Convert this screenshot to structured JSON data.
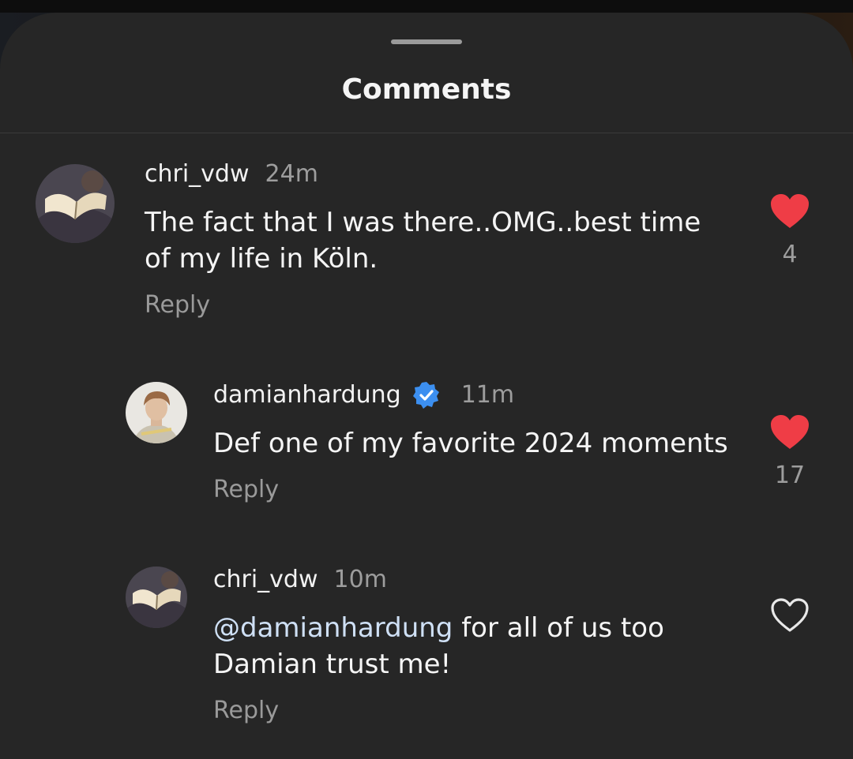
{
  "sheet": {
    "title": "Comments"
  },
  "comments": [
    {
      "username": "chri_vdw",
      "time": "24m",
      "text_line1": "The fact that I was there..OMG..best time",
      "text_line2": "of my life in Köln.",
      "reply_label": "Reply",
      "liked": true,
      "like_count": "4",
      "avatar": "open-book-photo"
    },
    {
      "username": "damianhardung",
      "verified": true,
      "time": "11m",
      "text_line1": "Def one of my favorite 2024 moments",
      "reply_label": "Reply",
      "liked": true,
      "like_count": "17",
      "avatar": "profile-photo"
    },
    {
      "username": "chri_vdw",
      "time": "10m",
      "mention": "@damianhardung",
      "text_line1_rest": " for all of us too",
      "text_line2": "Damian trust me!",
      "reply_label": "Reply",
      "liked": false,
      "avatar": "open-book-photo"
    }
  ],
  "colors": {
    "sheet_background": "#262626",
    "heart_liked": "#ef3d46",
    "verified_badge": "#3c8ff0",
    "mention": "#cfe0f5"
  }
}
